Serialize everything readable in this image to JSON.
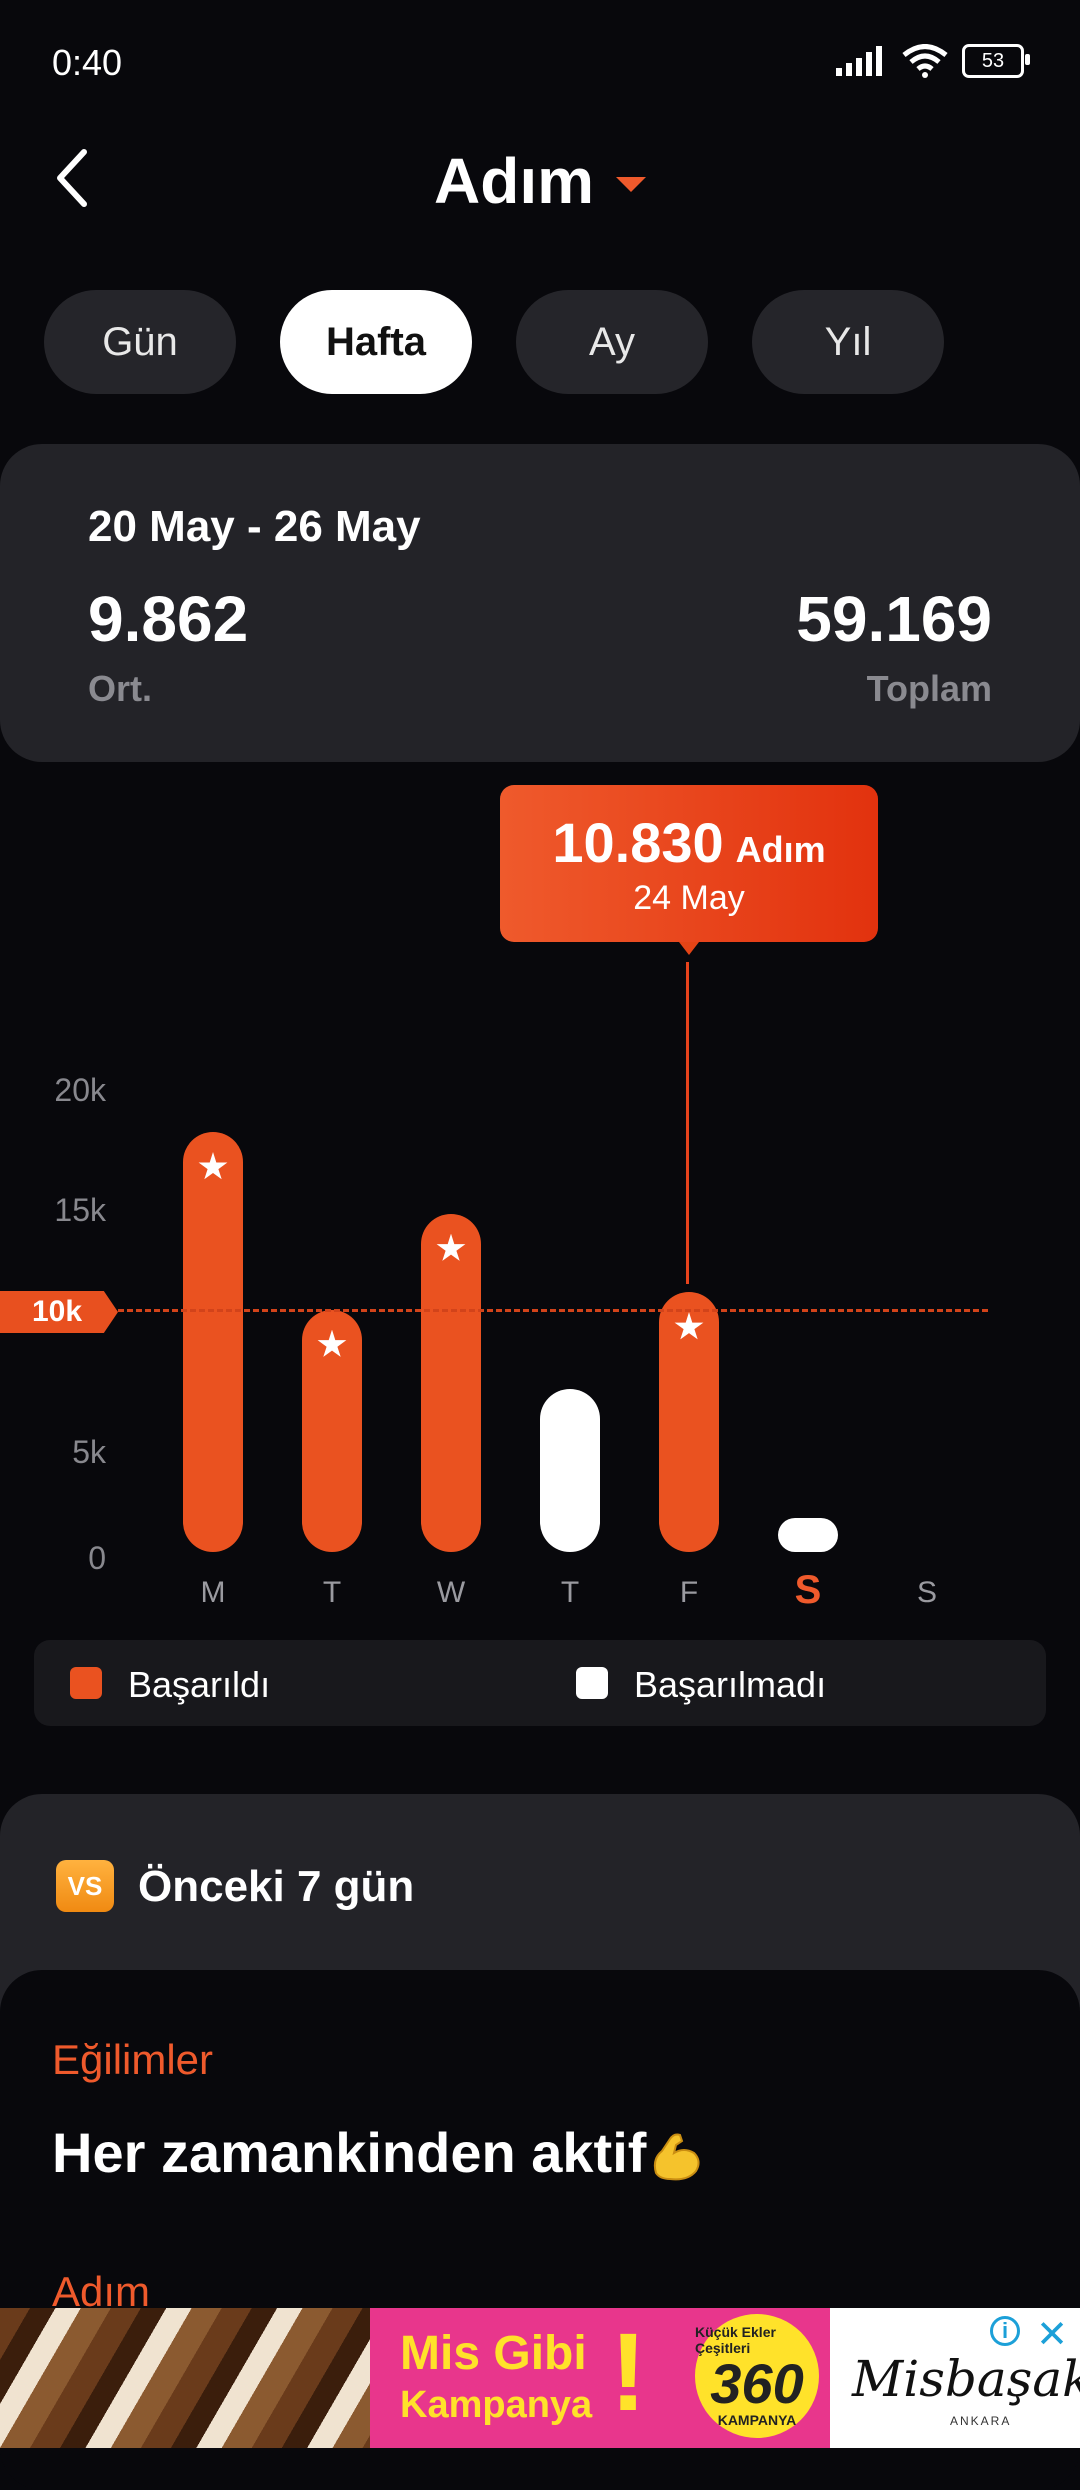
{
  "status": {
    "time": "0:40",
    "battery": "53"
  },
  "header": {
    "title": "Adım"
  },
  "tabs": [
    "Gün",
    "Hafta",
    "Ay",
    "Yıl"
  ],
  "summary": {
    "range": "20 May - 26 May",
    "average": "9.862",
    "average_label": "Ort.",
    "total": "59.169",
    "total_label": "Toplam"
  },
  "tooltip": {
    "value": "10.830",
    "unit": "Adım",
    "date": "24 May"
  },
  "goal": {
    "label": "10k",
    "value": 10000
  },
  "chart_data": {
    "type": "bar",
    "categories": [
      "M",
      "T",
      "W",
      "T",
      "F",
      "S",
      "S"
    ],
    "values": [
      17500,
      10100,
      14100,
      6800,
      10830,
      1000,
      0
    ],
    "achieved": [
      true,
      true,
      true,
      false,
      true,
      false,
      false
    ],
    "today_index": 5,
    "yticks": [
      "20k",
      "15k",
      "10k",
      "5k",
      "0"
    ],
    "ylim": [
      0,
      20000
    ],
    "goal": 10000,
    "legend": [
      "Başarıldı",
      "Başarılmadı"
    ],
    "colors": {
      "achieved": "#ea5220",
      "not_achieved": "#ffffff",
      "accent": "#ef5a2c"
    }
  },
  "legend": {
    "achieved": "Başarıldı",
    "not_achieved": "Başarılmadı"
  },
  "compare": {
    "badge": "VS",
    "title": "Önceki 7 gün"
  },
  "trends": {
    "heading": "Eğilimler",
    "message": "Her zamankinden aktif",
    "next_heading": "Adım"
  },
  "ad": {
    "line1": "Mis Gibi",
    "line2": "Kampanya",
    "exclaim": "!",
    "seal_top": "Küçük Ekler Çeşitleri",
    "seal_num": "360",
    "seal_bottom": "KAMPANYA",
    "brand": "Misbaşak",
    "brand_sub": "ANKARA"
  }
}
